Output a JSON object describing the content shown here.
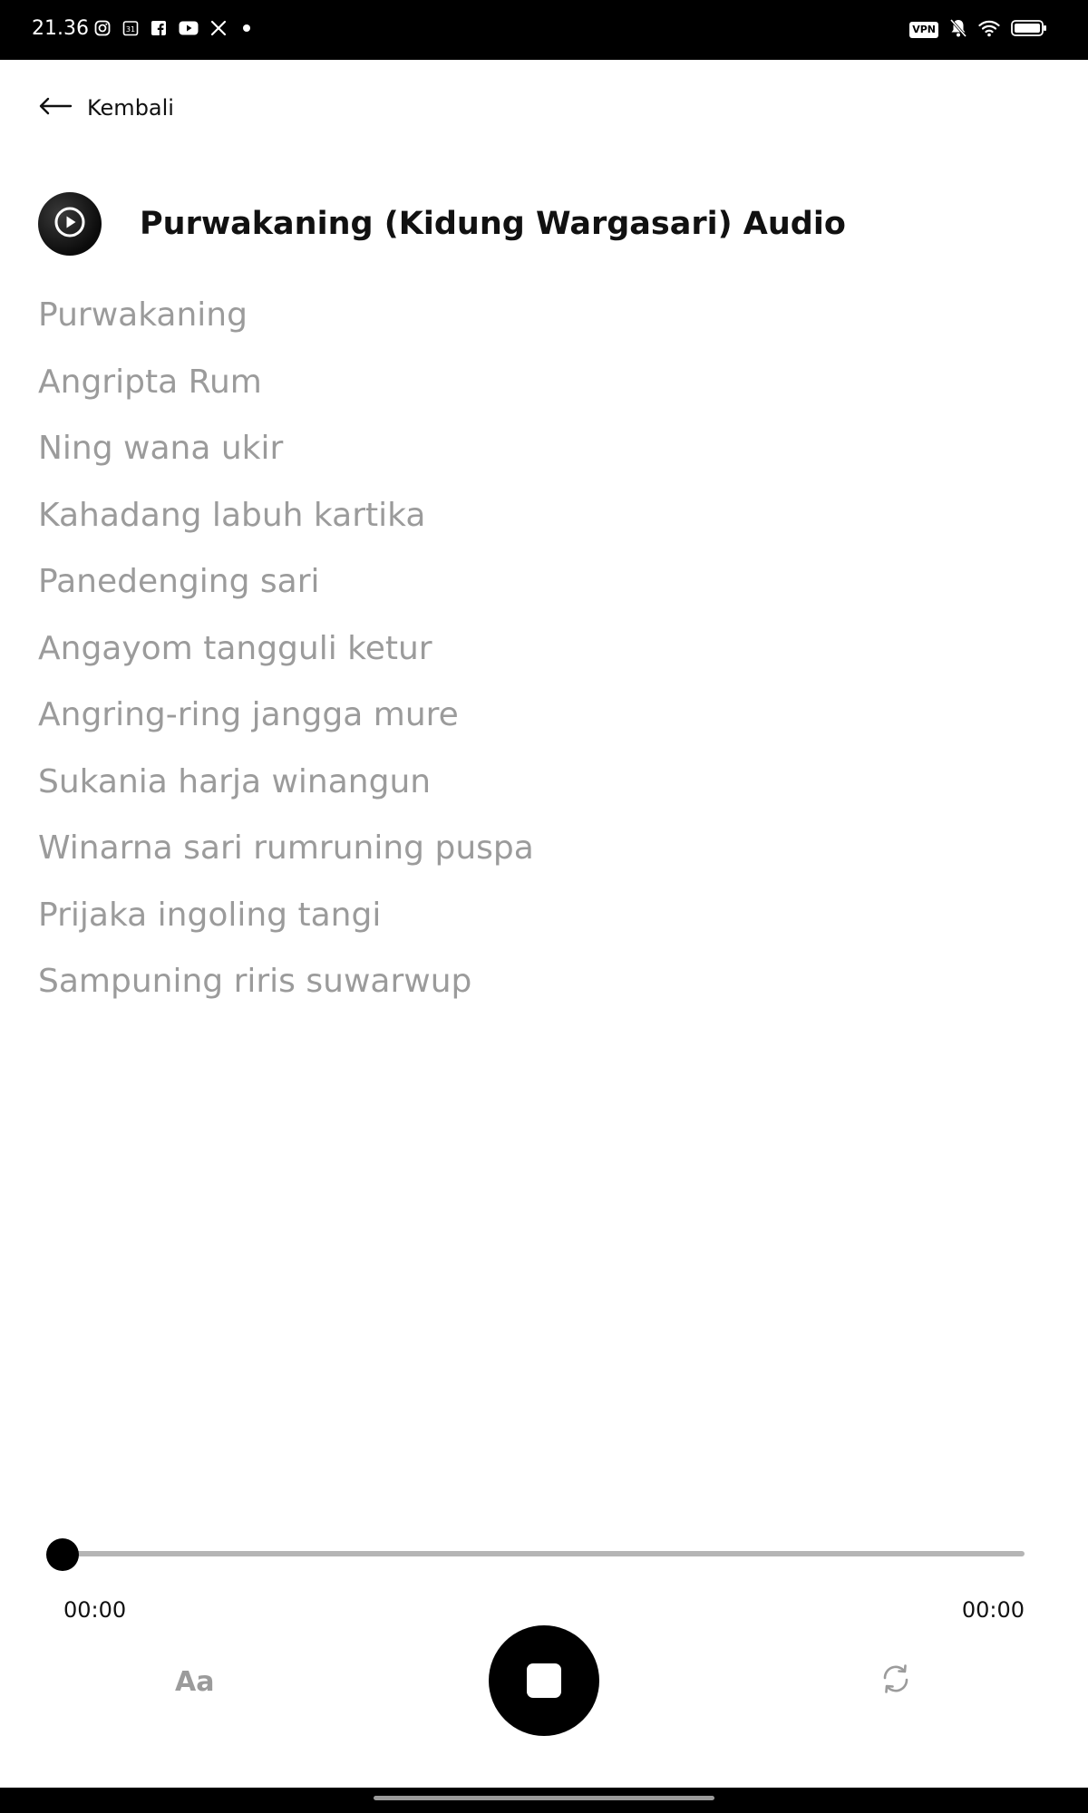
{
  "status_bar": {
    "time": "21.36",
    "left_icons": [
      "instagram-icon",
      "calendar-icon",
      "facebook-icon",
      "youtube-icon",
      "x-icon",
      "dot-icon"
    ],
    "calendar_day": "31",
    "vpn_label": "VPN",
    "right_icons": [
      "vpn-icon",
      "mute-icon",
      "wifi-icon",
      "battery-icon"
    ]
  },
  "nav": {
    "back_label": "Kembali"
  },
  "header": {
    "title": "Purwakaning (Kidung Wargasari) Audio",
    "avatar_icon": "play-circle-icon"
  },
  "lyrics": [
    "Purwakaning",
    "Angripta Rum",
    "Ning wana ukir",
    "Kahadang labuh kartika",
    "Panedenging sari",
    "Angayom tangguli ketur",
    "Angring-ring jangga mure",
    "Sukania harja winangun",
    "Winarna sari rumruning puspa",
    "Prijaka ingoling tangi",
    "Sampuning riris suwarwup"
  ],
  "player": {
    "progress": 0,
    "time_current": "00:00",
    "time_total": "00:00",
    "font_size_label": "Aa",
    "stop_icon": "stop-icon",
    "repeat_icon": "repeat-icon"
  },
  "colors": {
    "status_bar_bg": "#000000",
    "title_text": "#111111",
    "lyric_text": "#9b9b9b",
    "accent": "#000000",
    "track": "#b5b5b5"
  }
}
